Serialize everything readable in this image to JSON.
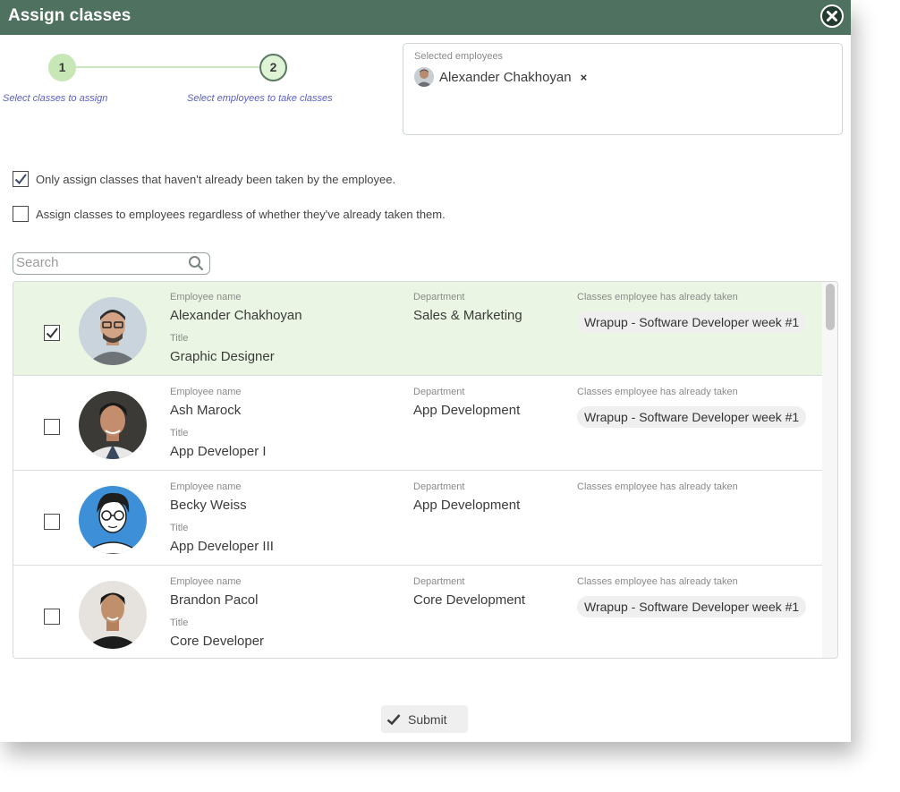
{
  "dialog": {
    "title": "Assign classes"
  },
  "stepper": {
    "steps": [
      {
        "number": "1",
        "label": "Select classes to assign"
      },
      {
        "number": "2",
        "label": "Select employees to take classes"
      }
    ],
    "current_step": 2
  },
  "selected_employees": {
    "label": "Selected employees",
    "chips": [
      {
        "name": "Alexander Chakhoyan",
        "remove": "×"
      }
    ]
  },
  "options": [
    {
      "label": "Only assign classes that haven't already been taken by the employee.",
      "checked": true
    },
    {
      "label": "Assign classes to employees regardless of whether they've already taken them.",
      "checked": false
    }
  ],
  "search": {
    "placeholder": "Search",
    "value": ""
  },
  "table": {
    "headers": {
      "name": "Employee name",
      "title": "Title",
      "department": "Department",
      "classes": "Classes employee has already taken"
    },
    "rows": [
      {
        "name": "Alexander Chakhoyan",
        "title": "Graphic Designer",
        "department": "Sales & Marketing",
        "classes": [
          "Wrapup - Software Developer week #1"
        ],
        "checked": true
      },
      {
        "name": "Ash Marock",
        "title": "App Developer I",
        "department": "App Development",
        "classes": [
          "Wrapup - Software Developer week #1"
        ],
        "checked": false
      },
      {
        "name": "Becky Weiss",
        "title": "App Developer III",
        "department": "App Development",
        "classes": [],
        "checked": false
      },
      {
        "name": "Brandon Pacol",
        "title": "Core Developer",
        "department": "Core Development",
        "classes": [
          "Wrapup - Software Developer week #1"
        ],
        "checked": false
      }
    ]
  },
  "submit_label": "Submit",
  "colors": {
    "titlebar": "#4e7160",
    "selected_row": "#eaf6e3",
    "step_done": "#c7e8b6",
    "step_link_text": "#5a5fc4"
  }
}
